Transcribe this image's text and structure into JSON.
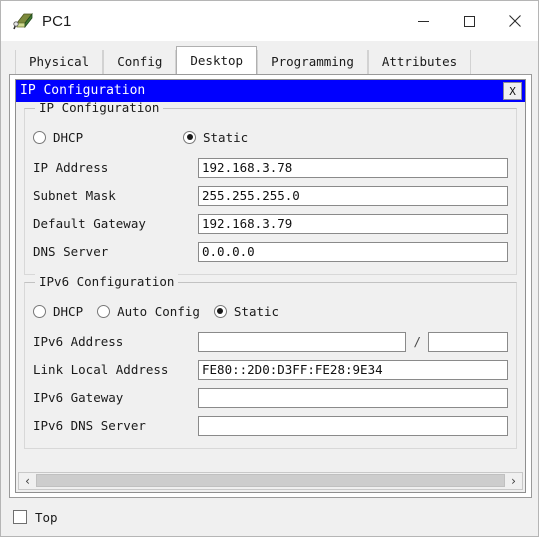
{
  "window": {
    "title": "PC1",
    "icon": "pc-device-icon",
    "controls": {
      "minimize": "minimize-icon",
      "maximize": "maximize-icon",
      "close": "close-icon"
    }
  },
  "tabs": [
    {
      "label": "Physical",
      "active": false
    },
    {
      "label": "Config",
      "active": false
    },
    {
      "label": "Desktop",
      "active": true
    },
    {
      "label": "Programming",
      "active": false
    },
    {
      "label": "Attributes",
      "active": false
    }
  ],
  "ip_config_window": {
    "title": "IP Configuration",
    "close_label": "X",
    "titlebar_color": "#0000FF",
    "titlebar_text_color": "#FFFFFF"
  },
  "ipv4": {
    "legend": "IP Configuration",
    "modes": [
      {
        "label": "DHCP",
        "selected": false
      },
      {
        "label": "Static",
        "selected": true
      }
    ],
    "fields": [
      {
        "label": "IP Address",
        "value": "192.168.3.78"
      },
      {
        "label": "Subnet Mask",
        "value": "255.255.255.0"
      },
      {
        "label": "Default Gateway",
        "value": "192.168.3.79"
      },
      {
        "label": "DNS Server",
        "value": "0.0.0.0"
      }
    ]
  },
  "ipv6": {
    "legend": "IPv6 Configuration",
    "modes": [
      {
        "label": "DHCP",
        "selected": false
      },
      {
        "label": "Auto Config",
        "selected": false
      },
      {
        "label": "Static",
        "selected": true
      }
    ],
    "address": {
      "label": "IPv6 Address",
      "value": "",
      "separator": "/",
      "prefix_value": ""
    },
    "fields": [
      {
        "label": "Link Local Address",
        "value": "FE80::2D0:D3FF:FE28:9E34"
      },
      {
        "label": "IPv6 Gateway",
        "value": ""
      },
      {
        "label": "IPv6 DNS Server",
        "value": ""
      }
    ]
  },
  "scrollbar": {
    "left_arrow": "‹",
    "right_arrow": "›"
  },
  "bottom": {
    "top_checkbox_label": "Top",
    "top_checkbox_checked": false
  }
}
